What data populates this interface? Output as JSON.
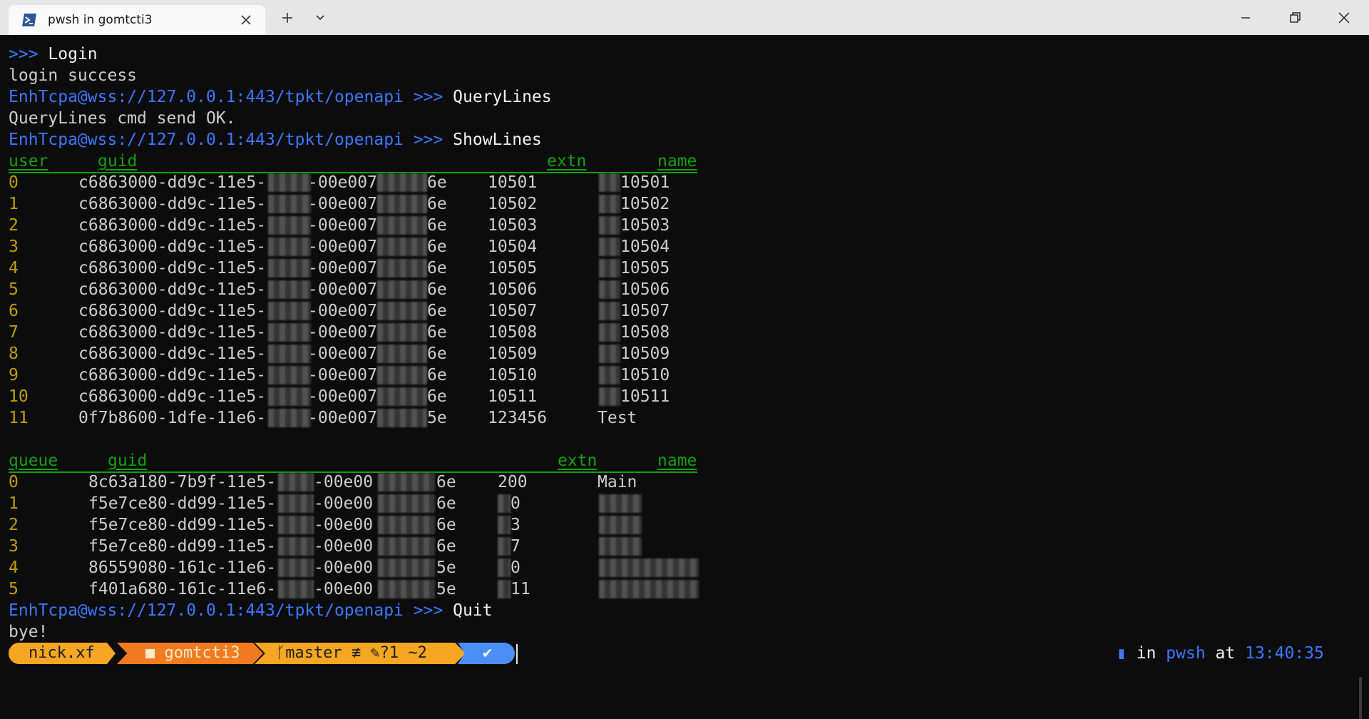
{
  "tab": {
    "title": "pwsh in gomtcti3",
    "new_tab": "+",
    "dropdown": "⌄"
  },
  "window": {
    "minimize": "—",
    "maximize": "❐",
    "close": "✕"
  },
  "lines": {
    "l1_prompt": ">>>",
    "l1_cmd": "Login",
    "l2": "login success",
    "l3_host": "EnhTcpa@wss://127.0.0.1:443/tpkt/openapi",
    "l3_prompt": ">>>",
    "l3_cmd": "QueryLines",
    "l4": "QueryLines cmd send OK.",
    "l5_host": "EnhTcpa@wss://127.0.0.1:443/tpkt/openapi",
    "l5_prompt": ">>>",
    "l5_cmd": "ShowLines",
    "quit_host": "EnhTcpa@wss://127.0.0.1:443/tpkt/openapi",
    "quit_prompt": ">>>",
    "quit_cmd": "Quit",
    "bye": "bye!"
  },
  "user_table": {
    "headers": {
      "user": "user",
      "guid": "guid",
      "extn": "extn",
      "name": "name"
    },
    "rows": [
      {
        "idx": "0",
        "guid_a": "c6863000-dd9c-11e5-",
        "guid_b": "-00e007",
        "guid_c": "6e",
        "extn": "10501",
        "name": "10501"
      },
      {
        "idx": "1",
        "guid_a": "c6863000-dd9c-11e5-",
        "guid_b": "-00e007",
        "guid_c": "6e",
        "extn": "10502",
        "name": "10502"
      },
      {
        "idx": "2",
        "guid_a": "c6863000-dd9c-11e5-",
        "guid_b": "-00e007",
        "guid_c": "6e",
        "extn": "10503",
        "name": "10503"
      },
      {
        "idx": "3",
        "guid_a": "c6863000-dd9c-11e5-",
        "guid_b": "-00e007",
        "guid_c": "6e",
        "extn": "10504",
        "name": "10504"
      },
      {
        "idx": "4",
        "guid_a": "c6863000-dd9c-11e5-",
        "guid_b": "-00e007",
        "guid_c": "6e",
        "extn": "10505",
        "name": "10505"
      },
      {
        "idx": "5",
        "guid_a": "c6863000-dd9c-11e5-",
        "guid_b": "-00e007",
        "guid_c": "6e",
        "extn": "10506",
        "name": "10506"
      },
      {
        "idx": "6",
        "guid_a": "c6863000-dd9c-11e5-",
        "guid_b": "-00e007",
        "guid_c": "6e",
        "extn": "10507",
        "name": "10507"
      },
      {
        "idx": "7",
        "guid_a": "c6863000-dd9c-11e5-",
        "guid_b": "-00e007",
        "guid_c": "6e",
        "extn": "10508",
        "name": "10508"
      },
      {
        "idx": "8",
        "guid_a": "c6863000-dd9c-11e5-",
        "guid_b": "-00e007",
        "guid_c": "6e",
        "extn": "10509",
        "name": "10509"
      },
      {
        "idx": "9",
        "guid_a": "c6863000-dd9c-11e5-",
        "guid_b": "-00e007",
        "guid_c": "6e",
        "extn": "10510",
        "name": "10510"
      },
      {
        "idx": "10",
        "guid_a": "c6863000-dd9c-11e5-",
        "guid_b": "-00e007",
        "guid_c": "6e",
        "extn": "10511",
        "name": "10511"
      },
      {
        "idx": "11",
        "guid_a": "0f7b8600-1dfe-11e6-",
        "guid_b": "-00e007",
        "guid_c": "5e",
        "extn": "123456",
        "name": "Test"
      }
    ]
  },
  "queue_table": {
    "headers": {
      "queue": "queue",
      "guid": "guid",
      "extn": "extn",
      "name": "name"
    },
    "rows": [
      {
        "idx": "0",
        "guid_a": "8c63a180-7b9f-11e5-",
        "guid_b": "-00e00",
        "guid_c": "6e",
        "extn": "200",
        "name": "Main"
      },
      {
        "idx": "1",
        "guid_a": "f5e7ce80-dd99-11e5-",
        "guid_b": "-00e00",
        "guid_c": "6e",
        "extn": "0",
        "name": ""
      },
      {
        "idx": "2",
        "guid_a": "f5e7ce80-dd99-11e5-",
        "guid_b": "-00e00",
        "guid_c": "6e",
        "extn": "3",
        "name": ""
      },
      {
        "idx": "3",
        "guid_a": "f5e7ce80-dd99-11e5-",
        "guid_b": "-00e00",
        "guid_c": "6e",
        "extn": "7",
        "name": ""
      },
      {
        "idx": "4",
        "guid_a": "86559080-161c-11e6-",
        "guid_b": "-00e00",
        "guid_c": "5e",
        "extn": "0",
        "name": ""
      },
      {
        "idx": "5",
        "guid_a": "f401a680-161c-11e6-",
        "guid_b": "-00e00",
        "guid_c": "5e",
        "extn": "11",
        "name": ""
      }
    ]
  },
  "prompt": {
    "user": "nick.xf",
    "dir": "gomtcti3",
    "git_branch": "master",
    "git_status": "≢ ✎?1 ~2",
    "ok": "✔",
    "right_in": "in",
    "right_shell": "pwsh",
    "right_at": "at",
    "right_time": "13:40:35"
  },
  "colors": {
    "background": "#0c0c0c",
    "host_blue": "#3b78ff",
    "header_green": "#13a10e",
    "index_yellow": "#c19c00"
  }
}
